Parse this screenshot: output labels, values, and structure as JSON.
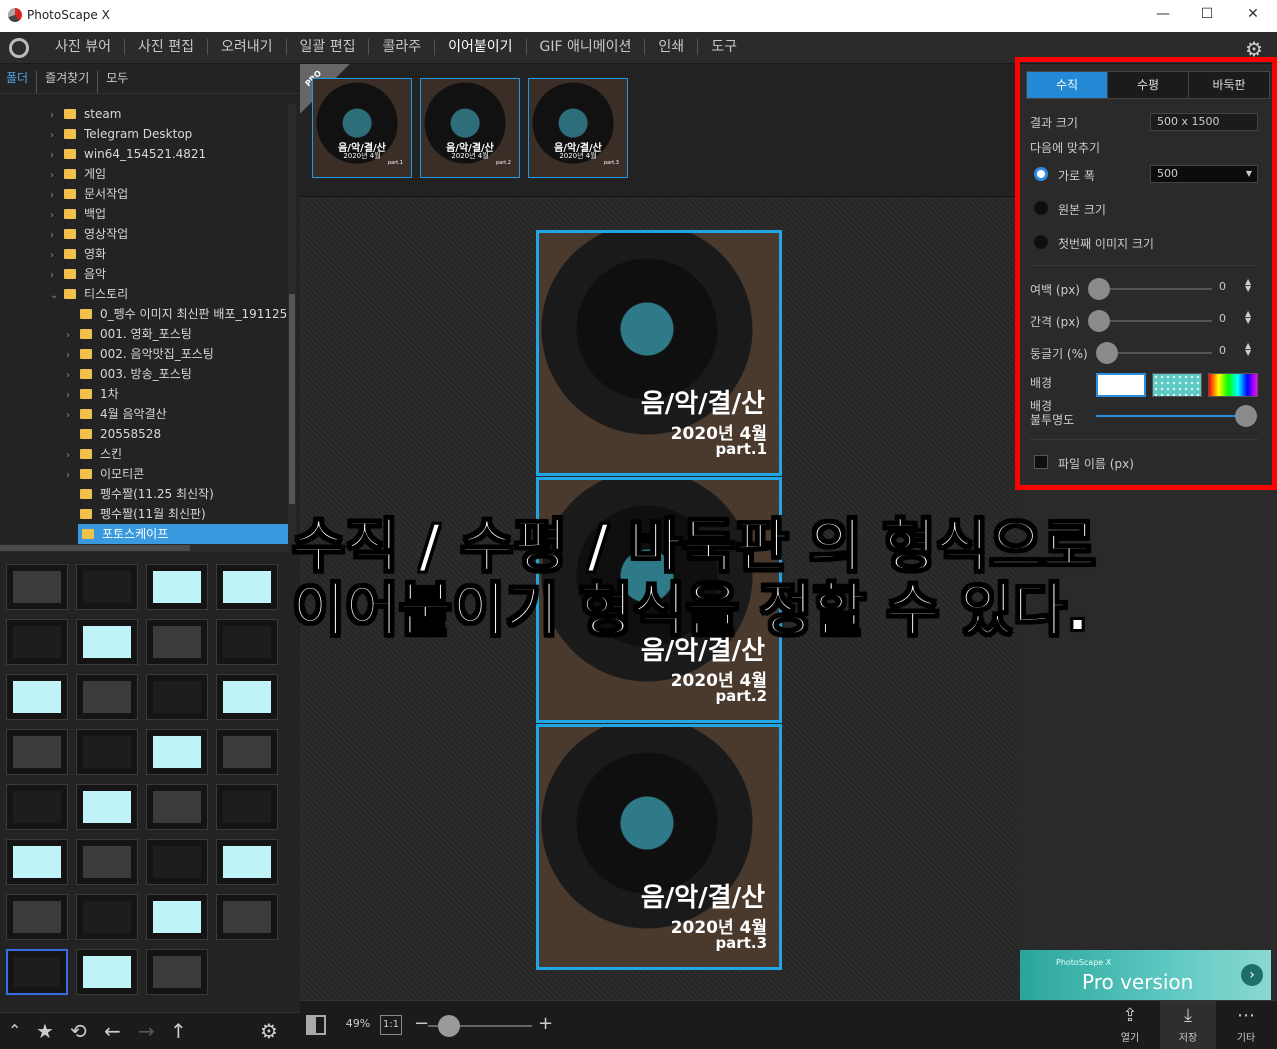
{
  "app": {
    "title": "PhotoScape X",
    "window_controls": {
      "minimize": "—",
      "maximize": "☐",
      "close": "✕"
    }
  },
  "menu": {
    "items": [
      "사진 뷰어",
      "사진 편집",
      "오려내기",
      "일괄 편집",
      "콜라주",
      "이어붙이기",
      "GIF 애니메이션",
      "인쇄",
      "도구"
    ],
    "active": "이어붙이기"
  },
  "left": {
    "tabs": [
      "폴더",
      "즐겨찾기",
      "모두"
    ],
    "tree": [
      {
        "label": "steam",
        "indent": 0,
        "arrow": "›"
      },
      {
        "label": "Telegram Desktop",
        "indent": 0,
        "arrow": "›"
      },
      {
        "label": "win64_154521.4821",
        "indent": 0,
        "arrow": "›"
      },
      {
        "label": "게임",
        "indent": 0,
        "arrow": "›"
      },
      {
        "label": "문서작업",
        "indent": 0,
        "arrow": "›"
      },
      {
        "label": "백업",
        "indent": 0,
        "arrow": "›"
      },
      {
        "label": "영상작업",
        "indent": 0,
        "arrow": "›"
      },
      {
        "label": "영화",
        "indent": 0,
        "arrow": "›"
      },
      {
        "label": "음악",
        "indent": 0,
        "arrow": "›"
      },
      {
        "label": "티스토리",
        "indent": 0,
        "arrow": "⌄"
      },
      {
        "label": "0_펭수 이미지 최신판 배포_191125",
        "indent": 1,
        "arrow": ""
      },
      {
        "label": "001. 영화_포스팅",
        "indent": 1,
        "arrow": "›"
      },
      {
        "label": "002. 음악맛집_포스팅",
        "indent": 1,
        "arrow": "›"
      },
      {
        "label": "003. 방송_포스팅",
        "indent": 1,
        "arrow": "›"
      },
      {
        "label": "1차",
        "indent": 1,
        "arrow": "›"
      },
      {
        "label": "4월 음악결산",
        "indent": 1,
        "arrow": "›"
      },
      {
        "label": "20558528",
        "indent": 1,
        "arrow": ""
      },
      {
        "label": "스킨",
        "indent": 1,
        "arrow": "›"
      },
      {
        "label": "이모티콘",
        "indent": 1,
        "arrow": "›"
      },
      {
        "label": "펭수짤(11.25 최신작)",
        "indent": 1,
        "arrow": ""
      },
      {
        "label": "펭수짤(11월 최신판)",
        "indent": 1,
        "arrow": ""
      },
      {
        "label": "포토스케이프",
        "indent": 1,
        "arrow": "",
        "selected": true
      }
    ],
    "bottom_icons": [
      "chevron-up-icon",
      "star-icon",
      "refresh-icon",
      "back-arrow-icon",
      "forward-arrow-icon",
      "up-arrow-icon",
      "gear-icon"
    ]
  },
  "strip": {
    "badge": "PRO",
    "thumbs": [
      {
        "t1": "음/악/결/산",
        "t2": "2020년 4월",
        "t3": "part.1"
      },
      {
        "t1": "음/악/결/산",
        "t2": "2020년 4월",
        "t3": "part.2"
      },
      {
        "t1": "음/악/결/산",
        "t2": "2020년 4월",
        "t3": "part.3"
      }
    ]
  },
  "canvas": {
    "panels": [
      {
        "t1": "음/악/결/산",
        "t2": "2020년 4월",
        "t3": "part.1"
      },
      {
        "t1": "음/악/결/산",
        "t2": "2020년 4월",
        "t3": "part.2"
      },
      {
        "t1": "음/악/결/산",
        "t2": "2020년 4월",
        "t3": "part.3"
      }
    ]
  },
  "overlay": {
    "line1": "수직 / 수평 / 바둑판 의 형식으로",
    "line2": "이어붙이기 형식을 정할 수 있다."
  },
  "mainbottom": {
    "zoom": "49%",
    "one_to_one": "1:1",
    "minus": "−",
    "plus": "+",
    "zoom_level": 0.15
  },
  "right": {
    "tabs": [
      "수직",
      "수평",
      "바둑판"
    ],
    "active_tab": "수직",
    "result_size_label": "결과 크기",
    "result_size_value": "500 x 1500",
    "fit_label": "다음에 맞추기",
    "option_width": "가로 폭",
    "option_width_value": "500",
    "option_original": "원본 크기",
    "option_first": "첫번째 이미지 크기",
    "margin_label": "여백 (px)",
    "margin_value": "0",
    "gap_label": "간격 (px)",
    "gap_value": "0",
    "round_label": "둥글기 (%)",
    "round_value": "0",
    "bg_label": "배경",
    "opacity_label_1": "배경",
    "opacity_label_2": "불투명도",
    "opacity_level": 1.0,
    "filename_label": "파일 이름 (px)",
    "pro_small": "PhotoScape X",
    "pro_big": "Pro version",
    "buttons": [
      {
        "label": "열기",
        "icon": "share-icon"
      },
      {
        "label": "저장",
        "icon": "download-icon"
      },
      {
        "label": "기타",
        "icon": "more-icon"
      }
    ]
  }
}
